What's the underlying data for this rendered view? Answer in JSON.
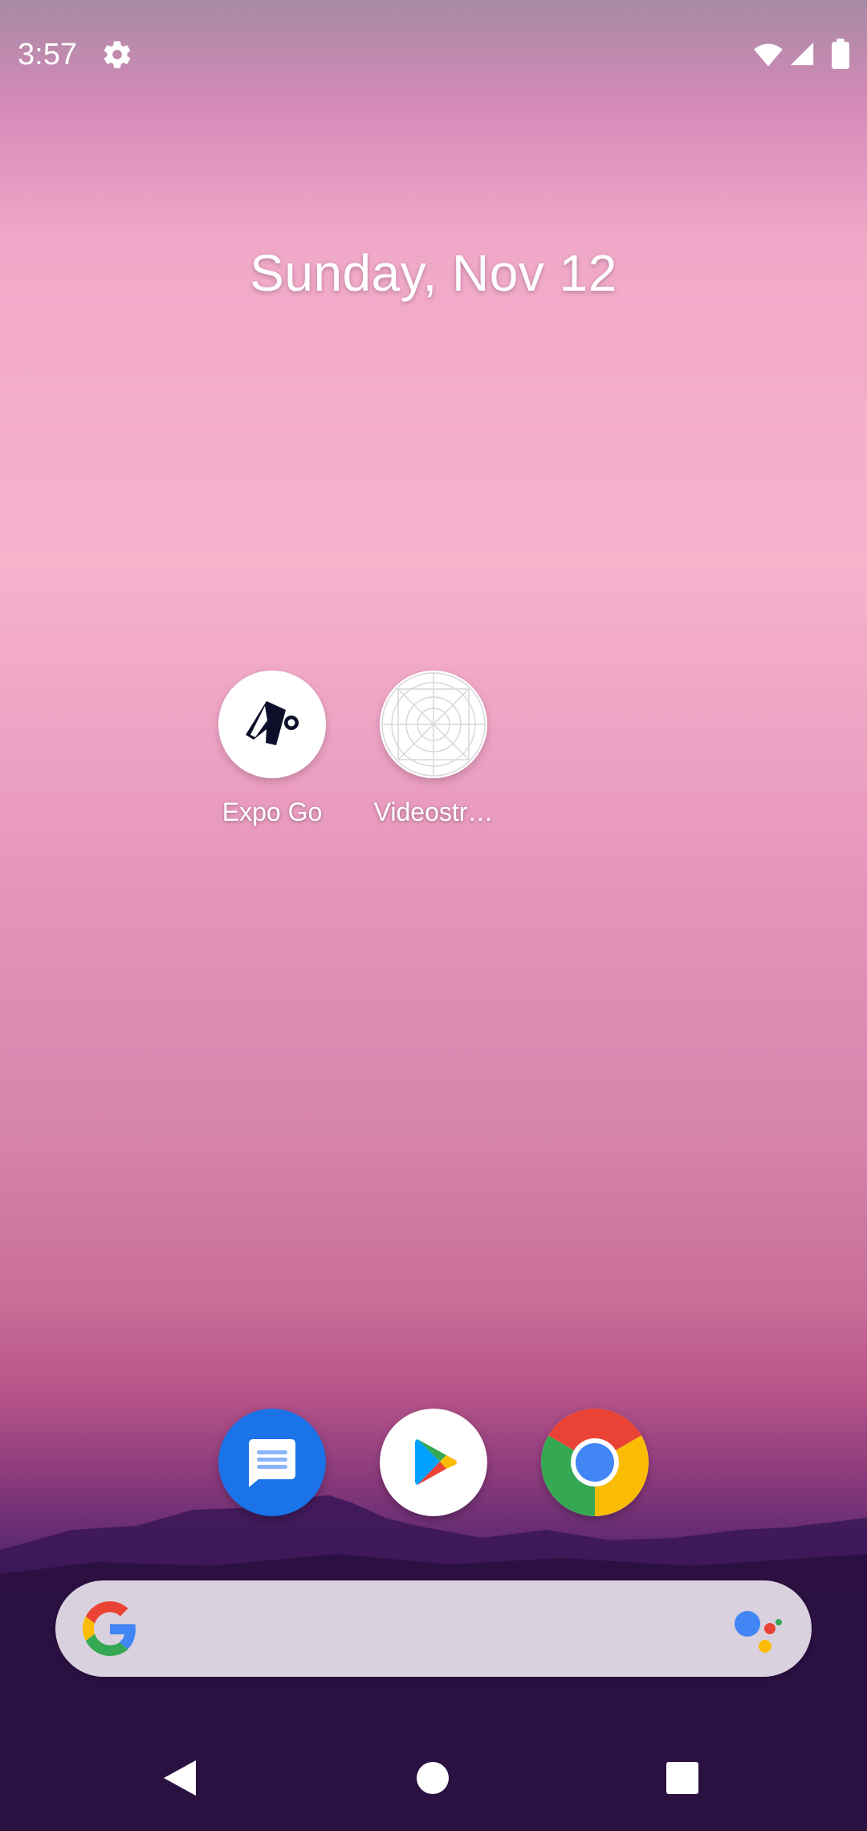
{
  "status_bar": {
    "time": "3:57",
    "settings_icon": "gear-icon",
    "wifi_icon": "wifi-icon",
    "signal_icon": "cell-signal-icon",
    "battery_icon": "battery-icon"
  },
  "home": {
    "date": "Sunday, Nov 12"
  },
  "apps": [
    {
      "label": "Expo Go",
      "icon": "expo-go-icon"
    },
    {
      "label": "Videostr…",
      "icon": "videostream-app-icon"
    }
  ],
  "dock": [
    {
      "icon": "messages-icon",
      "color": "#1a73e8"
    },
    {
      "icon": "play-store-icon",
      "color": "#ffffff"
    },
    {
      "icon": "chrome-icon",
      "color": "#ffffff"
    }
  ],
  "search": {
    "google_icon": "google-g-icon",
    "assistant_icon": "google-assistant-icon"
  },
  "navigation": {
    "back": "back-icon",
    "home": "home-icon",
    "recents": "recents-icon"
  },
  "colors": {
    "google_blue": "#4285f4",
    "google_red": "#ea4335",
    "google_yellow": "#fbbc04",
    "google_green": "#34a853",
    "expo_dark": "#0d0f2a"
  }
}
